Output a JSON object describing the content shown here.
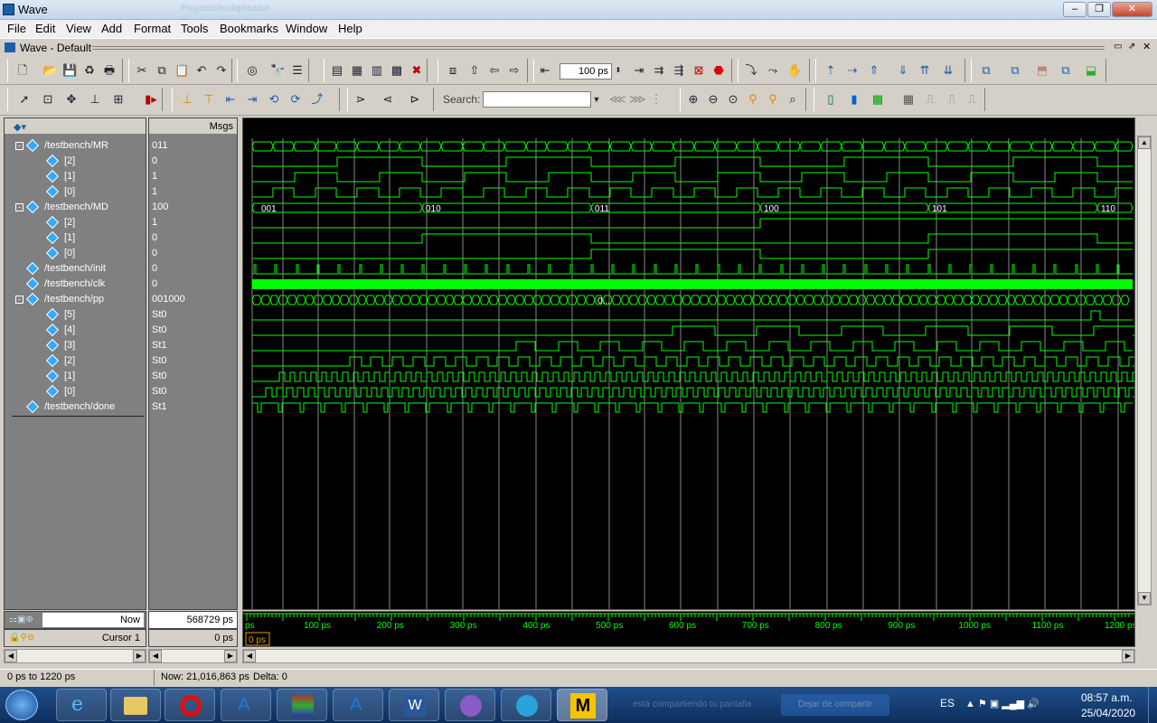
{
  "window": {
    "title": "Wave",
    "path": "Proyecto/multiplicador"
  },
  "menu": [
    "File",
    "Edit",
    "View",
    "Add",
    "Format",
    "Tools",
    "Bookmarks",
    "Window",
    "Help"
  ],
  "subwindow": {
    "title": "Wave - Default"
  },
  "toolbar": {
    "time_value": "100",
    "time_unit": "ps",
    "search_label": "Search:",
    "search_placeholder": ""
  },
  "header": {
    "msgs_label": "Msgs"
  },
  "signals": [
    {
      "name": "/testbench/MR",
      "value": "011",
      "expand": "-",
      "level": 0
    },
    {
      "name": "[2]",
      "value": "0",
      "level": 1
    },
    {
      "name": "[1]",
      "value": "1",
      "level": 1
    },
    {
      "name": "[0]",
      "value": "1",
      "level": 1
    },
    {
      "name": "/testbench/MD",
      "value": "100",
      "expand": "-",
      "level": 0
    },
    {
      "name": "[2]",
      "value": "1",
      "level": 1
    },
    {
      "name": "[1]",
      "value": "0",
      "level": 1
    },
    {
      "name": "[0]",
      "value": "0",
      "level": 1
    },
    {
      "name": "/testbench/init",
      "value": "0",
      "level": 0
    },
    {
      "name": "/testbench/clk",
      "value": "0",
      "level": 0
    },
    {
      "name": "/testbench/pp",
      "value": "001000",
      "expand": "-",
      "level": 0
    },
    {
      "name": "[5]",
      "value": "St0",
      "level": 1
    },
    {
      "name": "[4]",
      "value": "St0",
      "level": 1
    },
    {
      "name": "[3]",
      "value": "St1",
      "level": 1
    },
    {
      "name": "[2]",
      "value": "St0",
      "level": 1
    },
    {
      "name": "[1]",
      "value": "St0",
      "level": 1
    },
    {
      "name": "[0]",
      "value": "St0",
      "level": 1
    },
    {
      "name": "/testbench/done",
      "value": "St1",
      "level": 0
    }
  ],
  "md_bus_labels": [
    "001",
    "010",
    "011",
    "100",
    "101",
    "110"
  ],
  "pp_bus_label": "0...",
  "timeline": {
    "ticks": [
      "ps",
      "100 ps",
      "200 ps",
      "300 ps",
      "400 ps",
      "500 ps",
      "600 ps",
      "700 ps",
      "800 ps",
      "900 ps",
      "1000 ps",
      "1100 ps",
      "1200 ps"
    ],
    "cursor_value": "0 ps"
  },
  "now": {
    "label": "Now",
    "value": "568729 ps"
  },
  "cursor": {
    "label": "Cursor 1",
    "value": "0 ps"
  },
  "status": {
    "range": "0 ps to 1220 ps",
    "now": "Now: 21,016,863 ps",
    "delta": "Delta: 0"
  },
  "taskbar": {
    "lang": "ES",
    "time": "08:57 a.m.",
    "date": "25/04/2020",
    "notice": "está compartiendo tu pantalla",
    "stop_label": "Dejar de compartir"
  },
  "colors": {
    "wave": "#00ff00",
    "background": "#000000",
    "grid": "#888888",
    "bus_label": "#ffffff"
  }
}
